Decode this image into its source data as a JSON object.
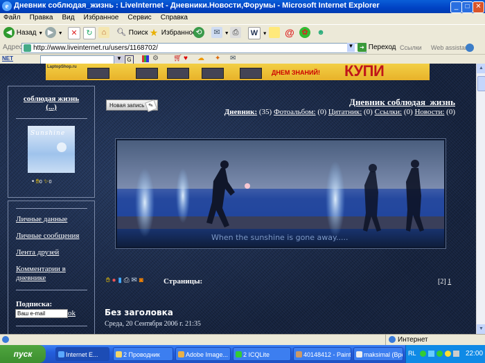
{
  "window": {
    "title": "Дневник соблюдая_жизнь : LiveInternet - Дневники.Новости,Форумы - Microsoft Internet Explorer"
  },
  "menu": [
    "Файл",
    "Правка",
    "Вид",
    "Избранное",
    "Сервис",
    "Справка"
  ],
  "toolbar": {
    "back": "Назад",
    "search": "Поиск",
    "favorites": "Избранное"
  },
  "address": {
    "label": "Адрес:",
    "url": "http://www.liveinternet.ru/users/1168702/",
    "go": "Переход",
    "links": "Ссылки",
    "assistant": "Web assistant"
  },
  "netbar": {
    "logo": "NET"
  },
  "banner": {
    "site": "LaptopShop.ru",
    "day": "ДНЕМ ЗНАНИЙ!",
    "buy": "КУПИ НОУТБУК"
  },
  "sidebar": {
    "username": "соблюдая жизнь",
    "username_more": "(...)",
    "avatar_text": "Sunshine",
    "links": [
      "Личные данные",
      "Личные сообщения",
      "Лента друзей",
      "Комментарии в дневнике"
    ],
    "subscribe_label": "Подписка:",
    "email_placeholder": "Ваш e-mail",
    "ok": "ok"
  },
  "content": {
    "new_post": "Новая запись",
    "diary_title": "Дневник соблюдая_жизнь",
    "stats": [
      {
        "label": "Дневник:",
        "count": "(35)"
      },
      {
        "label": "Фотоальбом:",
        "count": "(0)"
      },
      {
        "label": "Цитатник:",
        "count": "(0)"
      },
      {
        "label": "Ссылки:",
        "count": "(0)"
      },
      {
        "label": "Новости:",
        "count": "(0)"
      }
    ],
    "image_caption": "When the sunshine is gone away.....",
    "pages_label": "Страницы:",
    "page_current": "[2]",
    "page_link": "1",
    "post_title": "Без заголовка",
    "post_date": "Среда, 20 Сентября 2006 г. 21:35"
  },
  "statusbar": {
    "zone": "Интернет"
  },
  "taskbar": {
    "start": "пуск",
    "buttons": [
      "Internet E...",
      "2 Проводник",
      "Adobe Image...",
      "2 ICQLite",
      "40148412 - Paint",
      "maksimal (Вре..."
    ],
    "lang": "RL",
    "time": "22:00"
  },
  "colors": {
    "page_bg": "#1c2c4c",
    "link": "#ffffff",
    "banner_red": "#c0151a"
  }
}
